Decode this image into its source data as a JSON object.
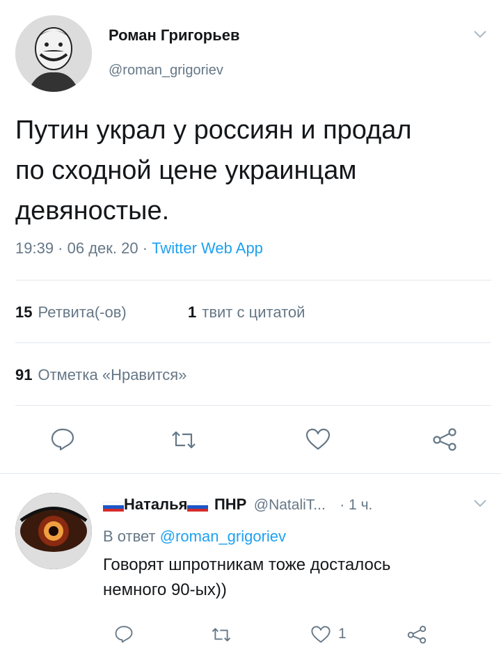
{
  "tweet": {
    "author_name": "Роман Григорьев",
    "author_handle": "@roman_grigoriev",
    "text_line1": "Путин украл у россиян и продал",
    "text_line2": "по сходной цене украинцам",
    "text_line3": "девяностые.",
    "meta_prefix": "19:39 · 06 дек. 20 · ",
    "source": "Twitter Web App",
    "retweets_count": "15",
    "retweets_label": "Ретвита(-ов)",
    "quotes_count": "1",
    "quotes_label": "твит с цитатой",
    "likes_count": "91",
    "likes_label": "Отметка «Нравится»"
  },
  "reply": {
    "author_name_part1": "Наталья",
    "author_name_part2": "ПНР",
    "author_handle": "@NataliT...",
    "time": "· 1 ч.",
    "replying_prefix": "В ответ ",
    "replying_to": "@roman_grigoriev",
    "text_line1": "Говорят шпротникам тоже досталось",
    "text_line2": "немного 90-ых))",
    "like_count": "1"
  },
  "colors": {
    "accent": "#1da1f2",
    "secondary_text": "#657786",
    "divider": "#e1e8ed"
  },
  "icons": [
    "reply-icon",
    "retweet-icon",
    "like-icon",
    "share-icon",
    "chevron-down-icon"
  ]
}
